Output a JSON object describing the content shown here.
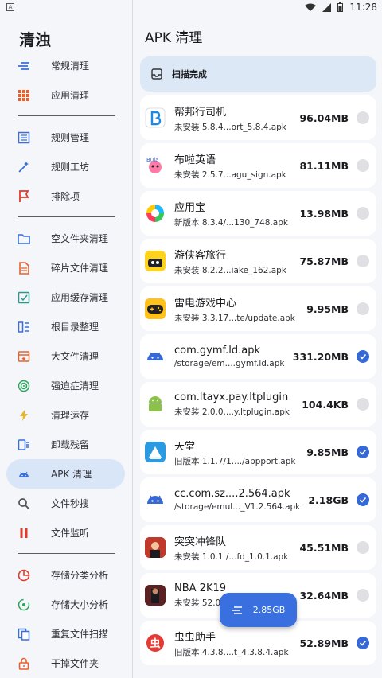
{
  "status_bar": {
    "time": "11:28",
    "left_icon": "A"
  },
  "drawer": {
    "title": "清浊",
    "groups": [
      [
        {
          "label": "常规清理",
          "icon": "lines-icon",
          "color": "#3b6fd8"
        },
        {
          "label": "应用清理",
          "icon": "grid-icon",
          "color": "#e8602c"
        }
      ],
      [
        {
          "label": "规则管理",
          "icon": "list-box-icon",
          "color": "#3b6fd8"
        },
        {
          "label": "规则工坊",
          "icon": "magic-wand-icon",
          "color": "#3b6fd8"
        },
        {
          "label": "排除项",
          "icon": "flag-icon",
          "color": "#e23a2a"
        }
      ],
      [
        {
          "label": "空文件夹清理",
          "icon": "folder-icon",
          "color": "#3b6fd8"
        },
        {
          "label": "碎片文件清理",
          "icon": "file-icon",
          "color": "#e8602c"
        },
        {
          "label": "应用缓存清理",
          "icon": "cache-icon",
          "color": "#2a9a8a"
        },
        {
          "label": "根目录整理",
          "icon": "columns-icon",
          "color": "#3b6fd8"
        },
        {
          "label": "大文件清理",
          "icon": "archive-icon",
          "color": "#e8602c"
        },
        {
          "label": "强迫症清理",
          "icon": "target-icon",
          "color": "#2aa55a"
        },
        {
          "label": "清理运存",
          "icon": "bolt-icon",
          "color": "#e8b62c"
        },
        {
          "label": "卸载残留",
          "icon": "uninstall-icon",
          "color": "#3b6fd8"
        },
        {
          "label": "APK 清理",
          "icon": "android-icon",
          "color": "#3b6fd8",
          "active": true
        },
        {
          "label": "文件秒搜",
          "icon": "search-icon",
          "color": "#555555"
        },
        {
          "label": "文件监听",
          "icon": "pause-icon",
          "color": "#e23a2a"
        }
      ],
      [
        {
          "label": "存储分类分析",
          "icon": "pie-icon",
          "color": "#e23a2a"
        },
        {
          "label": "存储大小分析",
          "icon": "dot-ring-icon",
          "color": "#2aa55a"
        },
        {
          "label": "重复文件扫描",
          "icon": "copy-icon",
          "color": "#3b6fd8"
        },
        {
          "label": "干掉文件夹",
          "icon": "lock-icon",
          "color": "#e8602c"
        }
      ]
    ]
  },
  "main": {
    "title": "APK 清理",
    "scan_status": "扫描完成"
  },
  "apks": [
    {
      "name": "帮邦行司机",
      "sub": "未安装 5.8.4...ort_5.8.4.apk",
      "size": "96.04MB",
      "checked": false,
      "icon": "bangbang-logo-icon",
      "bg": "#ffffff"
    },
    {
      "name": "布啦英语",
      "sub": "未安装 2.5.7...agu_sign.apk",
      "size": "81.11MB",
      "checked": false,
      "icon": "bula-logo-icon",
      "bg": "#ffffff"
    },
    {
      "name": "应用宝",
      "sub": "新版本 8.3.4/...130_748.apk",
      "size": "13.98MB",
      "checked": false,
      "icon": "yingyongbao-logo-icon",
      "bg": "#ffffff"
    },
    {
      "name": "游侠客旅行",
      "sub": "未安装 8.2.2...iake_162.apk",
      "size": "75.87MB",
      "checked": false,
      "icon": "youxiake-logo-icon",
      "bg": "#ffd21e"
    },
    {
      "name": "雷电游戏中心",
      "sub": "未安装 3.3.17...te/update.apk",
      "size": "9.95MB",
      "checked": false,
      "icon": "gamepad-icon",
      "bg": "#ffc21a"
    },
    {
      "name": "com.gymf.ld.apk",
      "sub": "/storage/em....gymf.ld.apk",
      "size": "331.20MB",
      "checked": true,
      "icon": "android-icon",
      "bg": "#ffffff"
    },
    {
      "name": "com.ltayx.pay.ltplugin",
      "sub": "未安装 2.0.0....y.ltplugin.apk",
      "size": "104.4KB",
      "checked": false,
      "icon": "android-green-icon",
      "bg": "#ffffff"
    },
    {
      "name": "天堂",
      "sub": "旧版本 1.1.7/1..../appport.apk",
      "size": "9.85MB",
      "checked": true,
      "icon": "tiantang-logo-icon",
      "bg": "#2a9be0"
    },
    {
      "name": "cc.com.sz....2.564.apk",
      "sub": "/storage/emul..._V1.2.564.apk",
      "size": "2.18GB",
      "checked": true,
      "icon": "android-icon",
      "bg": "#ffffff"
    },
    {
      "name": "突突冲锋队",
      "sub": "未安装 1.0.1 /...fd_1.0.1.apk",
      "size": "45.51MB",
      "checked": false,
      "icon": "game-art-icon",
      "bg": "#c0392b"
    },
    {
      "name": "NBA 2K19",
      "sub": "未安装 52.0...",
      "size": "32.64MB",
      "checked": false,
      "icon": "nba-art-icon",
      "bg": "#8e2b2b"
    },
    {
      "name": "虫虫助手",
      "sub": "旧版本 4.3.8....t_4.3.8.4.apk",
      "size": "52.89MB",
      "checked": true,
      "icon": "chongchong-logo-icon",
      "bg": "#ffffff"
    }
  ],
  "fab": {
    "label": "2.85GB",
    "icon": "lines-icon"
  },
  "colors": {
    "accent": "#3a6fe0",
    "scan_card": "#dce8f6",
    "active_item": "#d8e6f8"
  }
}
